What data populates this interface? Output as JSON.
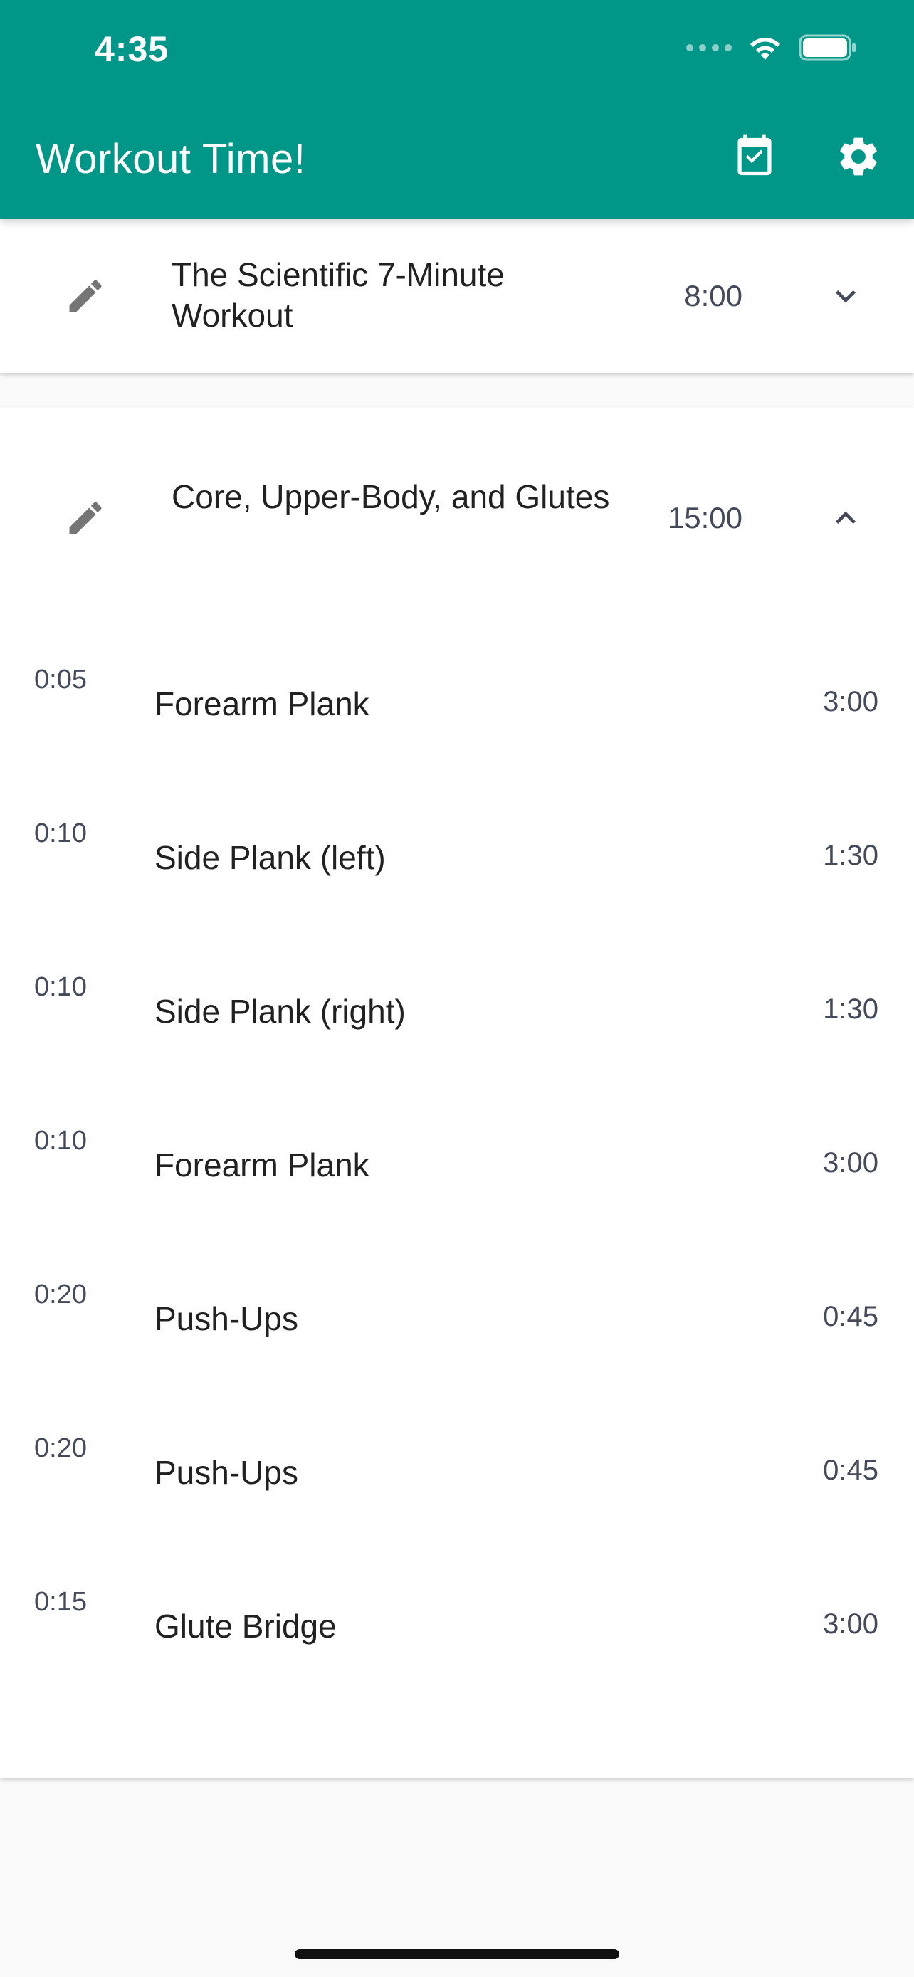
{
  "status_bar": {
    "time": "4:35"
  },
  "app_bar": {
    "title": "Workout Time!",
    "accent_color": "#009688",
    "actions": [
      {
        "icon": "calendar-check-icon"
      },
      {
        "icon": "gear-icon"
      }
    ]
  },
  "workouts": [
    {
      "title": "The Scientific 7-Minute Workout",
      "duration": "8:00",
      "expanded": false
    },
    {
      "title": "Core, Upper-Body, and Glutes",
      "duration": "15:00",
      "expanded": true,
      "exercises": [
        {
          "rest": "0:05",
          "name": "Forearm Plank",
          "duration": "3:00"
        },
        {
          "rest": "0:10",
          "name": "Side Plank (left)",
          "duration": "1:30"
        },
        {
          "rest": "0:10",
          "name": "Side Plank (right)",
          "duration": "1:30"
        },
        {
          "rest": "0:10",
          "name": "Forearm Plank",
          "duration": "3:00"
        },
        {
          "rest": "0:20",
          "name": "Push-Ups",
          "duration": "0:45"
        },
        {
          "rest": "0:20",
          "name": "Push-Ups",
          "duration": "0:45"
        },
        {
          "rest": "0:15",
          "name": "Glute Bridge",
          "duration": "3:00"
        }
      ]
    }
  ]
}
